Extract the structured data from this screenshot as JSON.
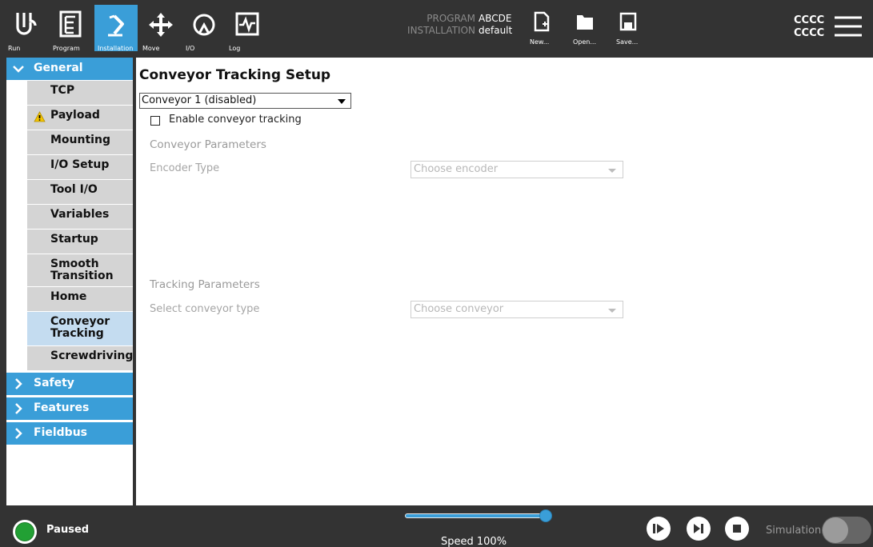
{
  "topbar": {
    "nav": [
      {
        "label": "Run",
        "icon": "ur-logo-icon"
      },
      {
        "label": "Program",
        "icon": "program-tree-icon"
      },
      {
        "label": "Installation",
        "icon": "installation-robot-arm-icon",
        "active": true
      },
      {
        "label": "Move",
        "icon": "move-arrows-icon"
      },
      {
        "label": "I/O",
        "icon": "io-gauge-icon"
      },
      {
        "label": "Log",
        "icon": "log-waveform-icon"
      }
    ],
    "program_key": "PROGRAM",
    "program_value": "ABCDE",
    "installation_key": "INSTALLATION",
    "installation_value": "default",
    "file_buttons": [
      {
        "label": "New...",
        "icon": "new-file-icon"
      },
      {
        "label": "Open...",
        "icon": "open-folder-icon"
      },
      {
        "label": "Save...",
        "icon": "save-disk-icon"
      }
    ],
    "user_line1": "CCCC",
    "user_line2": "CCCC",
    "menu_icon": "hamburger-menu-icon"
  },
  "sidebar": {
    "general": "General",
    "items": [
      {
        "label": "TCP"
      },
      {
        "label": "Payload",
        "warning": true
      },
      {
        "label": "Mounting"
      },
      {
        "label": "I/O Setup"
      },
      {
        "label": "Tool I/O"
      },
      {
        "label": "Variables"
      },
      {
        "label": "Startup"
      },
      {
        "label": "Smooth Transition"
      },
      {
        "label": "Home"
      },
      {
        "label": "Conveyor Tracking",
        "active": true
      },
      {
        "label": "Screwdriving"
      }
    ],
    "collapsed_sections": [
      "Safety",
      "Features",
      "Fieldbus"
    ]
  },
  "main": {
    "title": "Conveyor Tracking Setup",
    "conveyor_select": "Conveyor 1 (disabled)",
    "enable_label": "Enable conveyor tracking",
    "enable_checked": false,
    "conveyor_params_heading": "Conveyor Parameters",
    "encoder_type_label": "Encoder Type",
    "encoder_placeholder": "Choose encoder",
    "tracking_params_heading": "Tracking Parameters",
    "conveyor_type_label": "Select conveyor type",
    "conveyor_type_placeholder": "Choose conveyor"
  },
  "bottombar": {
    "status": "Paused",
    "speed_label": "Speed 100%",
    "speed_value": 100,
    "controls": [
      "play-icon",
      "step-icon",
      "stop-icon"
    ],
    "simulation_label": "Simulation",
    "simulation_on": false
  },
  "colors": {
    "accent": "#3a9ed8",
    "bar": "#333333",
    "status_green": "#22a034"
  }
}
